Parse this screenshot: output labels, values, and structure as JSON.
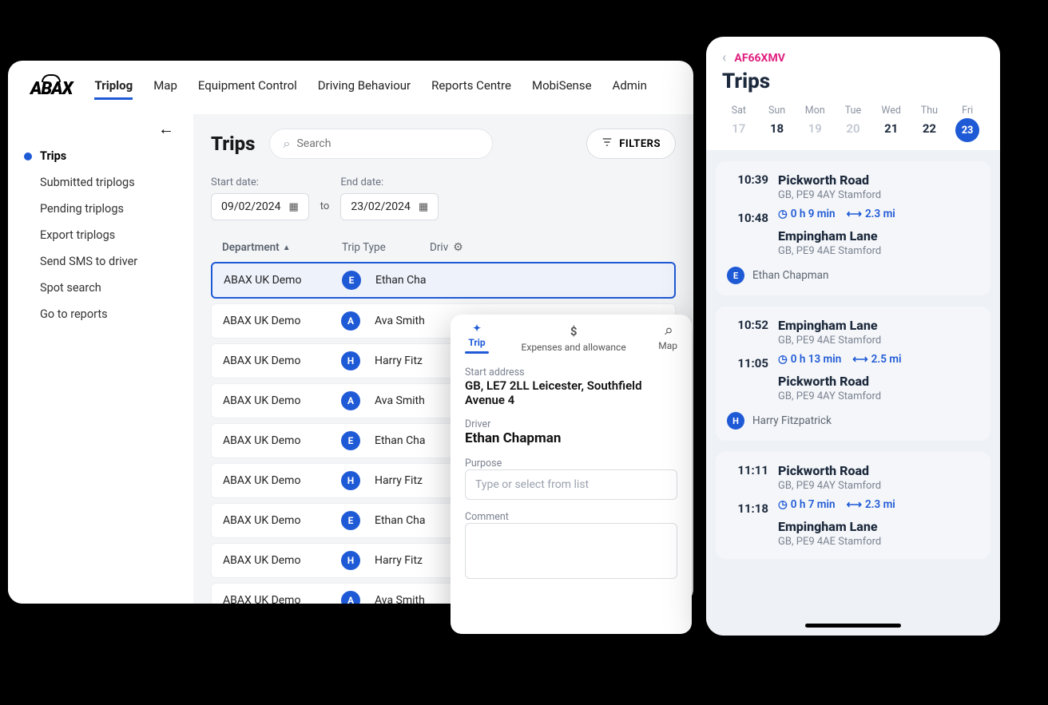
{
  "brand": "ABAX",
  "nav": {
    "items": [
      "Triplog",
      "Map",
      "Equipment Control",
      "Driving Behaviour",
      "Reports Centre",
      "MobiSense",
      "Admin"
    ],
    "active": 0
  },
  "sidebar": {
    "items": [
      "Trips",
      "Submitted triplogs",
      "Pending triplogs",
      "Export triplogs",
      "Send SMS to driver",
      "Spot search",
      "Go to reports"
    ],
    "active": 0
  },
  "trips": {
    "title": "Trips",
    "search_placeholder": "Search",
    "filters_label": "FILTERS",
    "start_label": "Start date:",
    "end_label": "End date:",
    "to_label": "to",
    "start_date": "09/02/2024",
    "end_date": "23/02/2024",
    "columns": {
      "dept": "Department",
      "trip_type": "Trip Type",
      "driver": "Driv"
    },
    "rows": [
      {
        "dept": "ABAX UK Demo",
        "type": "E",
        "driver": "Ethan Cha",
        "selected": true
      },
      {
        "dept": "ABAX UK Demo",
        "type": "A",
        "driver": "Ava Smith"
      },
      {
        "dept": "ABAX UK Demo",
        "type": "H",
        "driver": "Harry Fitz"
      },
      {
        "dept": "ABAX UK Demo",
        "type": "A",
        "driver": "Ava Smith"
      },
      {
        "dept": "ABAX UK Demo",
        "type": "E",
        "driver": "Ethan Cha"
      },
      {
        "dept": "ABAX UK Demo",
        "type": "H",
        "driver": "Harry Fitz"
      },
      {
        "dept": "ABAX UK Demo",
        "type": "E",
        "driver": "Ethan Cha"
      },
      {
        "dept": "ABAX UK Demo",
        "type": "H",
        "driver": "Harry Fitz"
      },
      {
        "dept": "ABAX UK Demo",
        "type": "A",
        "driver": "Ava Smith"
      }
    ]
  },
  "detail": {
    "tabs": {
      "trip": "Trip",
      "exp": "Expenses and allowance",
      "map": "Map"
    },
    "active_tab": "trip",
    "start_address_label": "Start address",
    "start_address": "GB, LE7 2LL Leicester, Southfield Avenue 4",
    "driver_label": "Driver",
    "driver": "Ethan Chapman",
    "purpose_label": "Purpose",
    "purpose_placeholder": "Type or select from list",
    "comment_label": "Comment"
  },
  "mobile": {
    "plate": "AF66XMV",
    "title": "Trips",
    "week": [
      {
        "d": "Sat",
        "n": "17",
        "state": "inactive"
      },
      {
        "d": "Sun",
        "n": "18",
        "state": "normal"
      },
      {
        "d": "Mon",
        "n": "19",
        "state": "inactive"
      },
      {
        "d": "Tue",
        "n": "20",
        "state": "inactive"
      },
      {
        "d": "Wed",
        "n": "21",
        "state": "normal"
      },
      {
        "d": "Thu",
        "n": "22",
        "state": "normal"
      },
      {
        "d": "Fri",
        "n": "23",
        "state": "active"
      }
    ],
    "cards": [
      {
        "t1": "10:39",
        "p1": "Pickworth Road",
        "s1": "GB, PE9 4AY Stamford",
        "dur": "0 h 9 min",
        "dist": "2.3 mi",
        "t2": "10:48",
        "p2": "Empingham Lane",
        "s2": "GB, PE9 4AE Stamford",
        "driver_initial": "E",
        "driver": "Ethan Chapman"
      },
      {
        "t1": "10:52",
        "p1": "Empingham Lane",
        "s1": "GB, PE9 4AE Stamford",
        "dur": "0 h 13 min",
        "dist": "2.5 mi",
        "t2": "11:05",
        "p2": "Pickworth Road",
        "s2": "GB, PE9 4AY Stamford",
        "driver_initial": "H",
        "driver": "Harry Fitzpatrick"
      },
      {
        "t1": "11:11",
        "p1": "Pickworth Road",
        "s1": "GB, PE9 4AY Stamford",
        "dur": "0 h 7 min",
        "dist": "2.3 mi",
        "t2": "11:18",
        "p2": "Empingham Lane",
        "s2": "GB, PE9 4AE Stamford"
      }
    ]
  }
}
